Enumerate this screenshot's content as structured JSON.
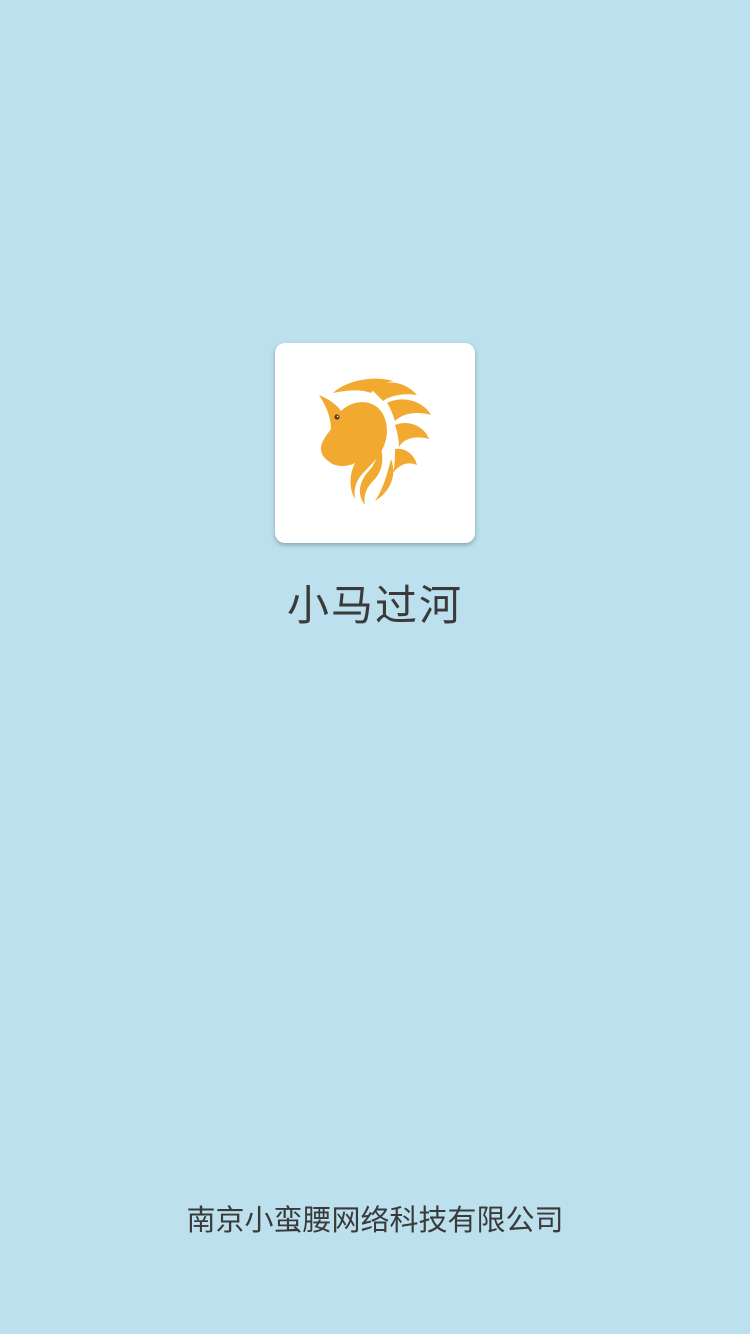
{
  "app": {
    "name": "小马过河",
    "icon": "horse-head-icon",
    "accent_color": "#f1a930",
    "background_color": "#bce0ee"
  },
  "footer": {
    "company": "南京小蛮腰网络科技有限公司"
  }
}
